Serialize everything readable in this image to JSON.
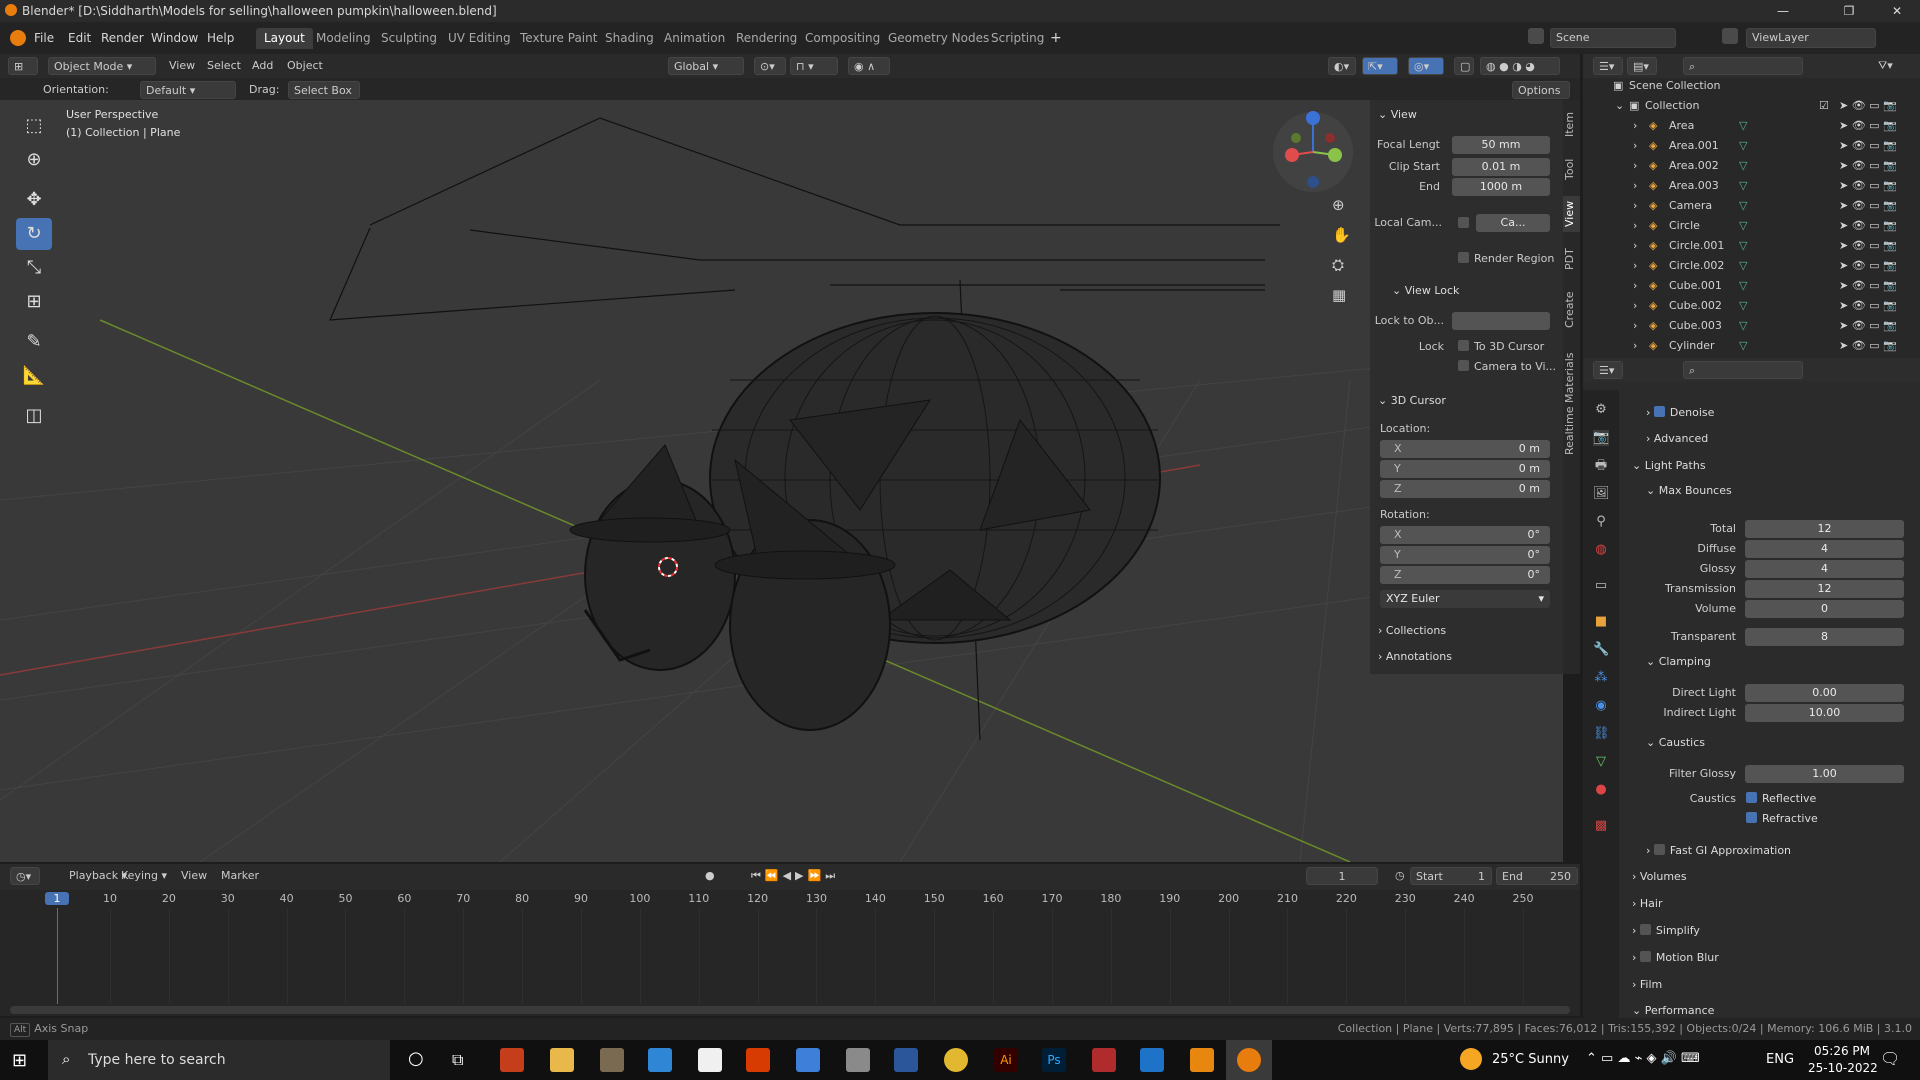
{
  "window": {
    "title": "Blender* [D:\\Siddharth\\Models for selling\\halloween pumpkin\\halloween.blend]",
    "min": "—",
    "max": "❐",
    "close": "✕"
  },
  "menu": {
    "items": [
      "File",
      "Edit",
      "Render",
      "Window",
      "Help"
    ]
  },
  "workspaces": [
    "Layout",
    "Modeling",
    "Sculpting",
    "UV Editing",
    "Texture Paint",
    "Shading",
    "Animation",
    "Rendering",
    "Compositing",
    "Geometry Nodes",
    "Scripting"
  ],
  "scene": {
    "name": "Scene",
    "viewlayer": "ViewLayer"
  },
  "header3d": {
    "mode": "Object Mode",
    "view": "View",
    "select": "Select",
    "add": "Add",
    "object": "Object",
    "transform": "Global"
  },
  "header2": {
    "orientation_label": "Orientation:",
    "orientation": "Default",
    "drag_label": "Drag:",
    "drag": "Select Box",
    "options": "Options"
  },
  "viewport": {
    "perspective": "User Perspective",
    "collection": "(1) Collection | Plane"
  },
  "npanel": {
    "view_title": "View",
    "focal_label": "Focal Lengt",
    "focal": "50 mm",
    "clip_start_label": "Clip Start",
    "clip_start": "0.01 m",
    "end_label": "End",
    "end": "1000 m",
    "local_cam_label": "Local Cam...",
    "local_cam": "Ca...",
    "render_region": "Render Region",
    "view_lock": "View Lock",
    "lock_obj_label": "Lock to Ob...",
    "lock_label": "Lock",
    "to_cursor": "To 3D Cursor",
    "camera_to_view": "Camera to Vi...",
    "cursor_title": "3D Cursor",
    "location": "Location:",
    "rotation": "Rotation:",
    "loc": [
      {
        "axis": "X",
        "val": "0 m"
      },
      {
        "axis": "Y",
        "val": "0 m"
      },
      {
        "axis": "Z",
        "val": "0 m"
      }
    ],
    "rot": [
      {
        "axis": "X",
        "val": "0°"
      },
      {
        "axis": "Y",
        "val": "0°"
      },
      {
        "axis": "Z",
        "val": "0°"
      }
    ],
    "rot_mode": "XYZ Euler",
    "collections": "Collections",
    "annotations": "Annotations"
  },
  "vtabs": [
    "Item",
    "Tool",
    "View",
    "PDT",
    "Create",
    "Realtime Materials"
  ],
  "outliner": {
    "root": "Scene Collection",
    "collection": "Collection",
    "items": [
      "Area",
      "Area.001",
      "Area.002",
      "Area.003",
      "Camera",
      "Circle",
      "Circle.001",
      "Circle.002",
      "Cube.001",
      "Cube.002",
      "Cube.003",
      "Cylinder"
    ]
  },
  "props": {
    "denoise": "Denoise",
    "advanced": "Advanced",
    "light_paths": "Light Paths",
    "max_bounces": "Max Bounces",
    "bounces": [
      {
        "label": "Total",
        "val": "12"
      },
      {
        "label": "Diffuse",
        "val": "4"
      },
      {
        "label": "Glossy",
        "val": "4"
      },
      {
        "label": "Transmission",
        "val": "12"
      },
      {
        "label": "Volume",
        "val": "0"
      },
      {
        "label": "Transparent",
        "val": "8"
      }
    ],
    "clamping": "Clamping",
    "direct_label": "Direct Light",
    "direct": "0.00",
    "indirect_label": "Indirect Light",
    "indirect": "10.00",
    "caustics": "Caustics",
    "filter_label": "Filter Glossy",
    "filter": "1.00",
    "caustics_label": "Caustics",
    "reflective": "Reflective",
    "refractive": "Refractive",
    "fast_gi": "Fast GI Approximation",
    "volumes": "Volumes",
    "hair": "Hair",
    "simplify": "Simplify",
    "motion_blur": "Motion Blur",
    "film": "Film",
    "performance": "Performance"
  },
  "timeline": {
    "playback": "Playback",
    "keying": "Keying",
    "view": "View",
    "marker": "Marker",
    "current": "1",
    "start_label": "Start",
    "start": "1",
    "end_label": "End",
    "end": "250",
    "ticks": [
      "1",
      "10",
      "20",
      "30",
      "40",
      "50",
      "60",
      "70",
      "80",
      "90",
      "100",
      "110",
      "120",
      "130",
      "140",
      "150",
      "160",
      "170",
      "180",
      "190",
      "200",
      "210",
      "220",
      "230",
      "240",
      "250"
    ]
  },
  "status": {
    "left": "Axis Snap",
    "right": "Collection | Plane | Verts:77,895 | Faces:76,012 | Tris:155,392 | Objects:0/24 | Memory: 106.6 MiB | 3.1.0"
  },
  "taskbar": {
    "search": "Type here to search",
    "weather": "25°C  Sunny",
    "lang": "ENG",
    "time": "05:26 PM",
    "date": "25-10-2022"
  }
}
